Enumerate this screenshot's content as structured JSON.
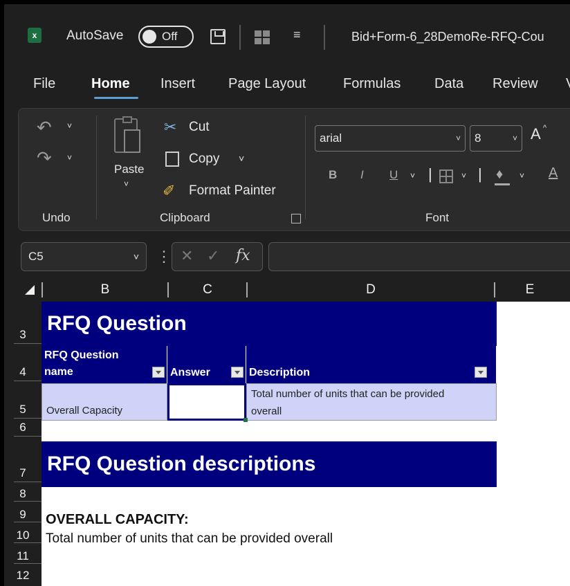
{
  "titlebar": {
    "app_icon_letter": "x",
    "autosave_label": "AutoSave",
    "autosave_state": "Off",
    "doc_title": "Bid+Form-6_28DemoRe-RFQ-Cou"
  },
  "menu": {
    "tabs": [
      "File",
      "Home",
      "Insert",
      "Page Layout",
      "Formulas",
      "Data",
      "Review",
      "V"
    ],
    "active": "Home"
  },
  "ribbon": {
    "undo_group": "Undo",
    "clipboard_group": "Clipboard",
    "paste": "Paste",
    "cut": "Cut",
    "copy": "Copy",
    "format_painter": "Format Painter",
    "font_group": "Font",
    "font_name": "arial",
    "font_size": "8",
    "bold": "B",
    "italic": "I",
    "underline": "U",
    "grow_font": "A",
    "font_color": "A"
  },
  "formula_bar": {
    "name_box": "C5",
    "fx": "fx",
    "formula": ""
  },
  "columns": [
    "B",
    "C",
    "D",
    "E"
  ],
  "rows": [
    "3",
    "4",
    "5",
    "6",
    "7",
    "8",
    "9",
    "10",
    "11",
    "12"
  ],
  "sheet": {
    "title": "RFQ Question",
    "headers": {
      "name": "RFQ Question name",
      "answer": "Answer",
      "description": "Description"
    },
    "row5": {
      "name": "Overall Capacity",
      "answer": "",
      "description": "Total number of units that can be provided overall"
    },
    "descriptions_title": "RFQ Question descriptions",
    "capacity_heading": "OVERALL CAPACITY:",
    "capacity_text": "Total number of units that can be provided overall"
  },
  "colors": {
    "header_navy": "#00007f",
    "data_row": "#cfd3f7",
    "excel_green": "#1d6f42"
  }
}
